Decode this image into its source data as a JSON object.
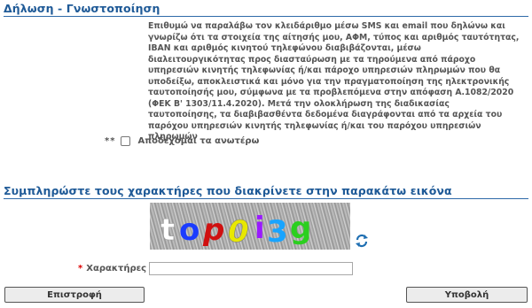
{
  "declaration": {
    "title": "Δήλωση - Γνωστοποίηση",
    "text": "Επιθυμώ να παραλάβω τον κλειδάριθμο μέσω SMS και email που δηλώνω και γνωρίζω ότι τα στοιχεία της αίτησής μου, ΑΦΜ, τύπος και αριθμός ταυτότητας, IBAN και αριθμός κινητού τηλεφώνου διαβιβάζονται, μέσω διαλειτουργικότητας προς διασταύρωση με τα τηρούμενα από πάροχο υπηρεσιών κινητής τηλεφωνίας ή/και πάροχο υπηρεσιών πληρωμών που θα υποδείξω, αποκλειστικά και μόνο για την πραγματοποίηση της ηλεκτρονικής ταυτοποίησής μου, σύμφωνα με τα προβλεπόμενα στην απόφαση Α.1082/2020 (ΦΕΚ Β' 1303/11.4.2020). Μετά την ολοκλήρωση της διαδικασίας ταυτοποίησης, τα διαβιβασθέντα δεδομένα διαγράφονται από τα αρχεία του παρόχου υπηρεσιών κινητής τηλεφωνίας ή/και του παρόχου υπηρεσιών πληρωμών",
    "required_marker": "**",
    "accept_label": "Αποδέχομαι τα ανωτέρω"
  },
  "captcha": {
    "title": "Συμπληρώστε τους χαρακτήρες που διακρίνετε στην παρακάτω εικόνα",
    "image_text": "top0i3g",
    "refresh_icon": "refresh-icon"
  },
  "form": {
    "required_mark": "*",
    "chars_label": "Χαρακτήρες",
    "chars_value": ""
  },
  "buttons": {
    "back": "Επιστροφή",
    "submit": "Υποβολή"
  },
  "colors": {
    "title": "#1f5a97",
    "rule": "#2e6aa8",
    "required": "#dd0000"
  }
}
